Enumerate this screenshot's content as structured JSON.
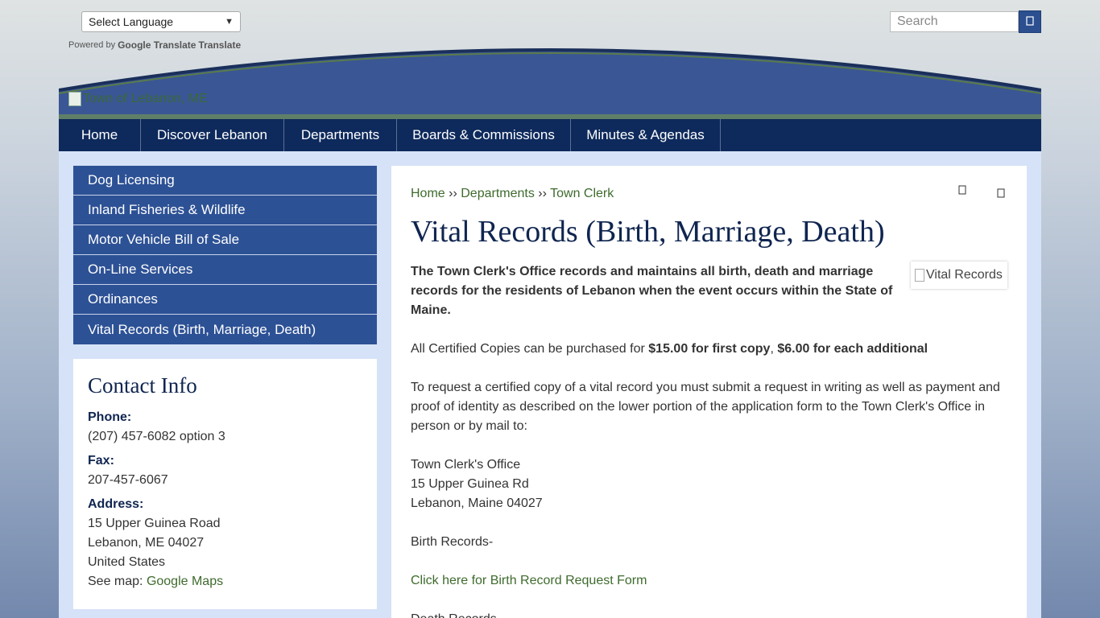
{
  "utility": {
    "language_select": "Select Language",
    "powered_by": "Powered by",
    "google_translate_logo": "Google Translate",
    "translate_link": "Translate",
    "search_placeholder": "Search"
  },
  "header": {
    "logo_alt": "Town of Lebanon, ME"
  },
  "nav": {
    "items": [
      {
        "label": "Home"
      },
      {
        "label": "Discover Lebanon"
      },
      {
        "label": "Departments"
      },
      {
        "label": "Boards & Commissions"
      },
      {
        "label": "Minutes & Agendas"
      }
    ]
  },
  "sidebar": {
    "items": [
      {
        "label": "Dog Licensing"
      },
      {
        "label": "Inland Fisheries & Wildlife"
      },
      {
        "label": "Motor Vehicle Bill of Sale"
      },
      {
        "label": "On-Line Services"
      },
      {
        "label": "Ordinances"
      },
      {
        "label": "Vital Records (Birth, Marriage, Death)"
      }
    ]
  },
  "contact": {
    "title": "Contact Info",
    "phone_label": "Phone:",
    "phone": "(207) 457-6082 option 3",
    "fax_label": "Fax:",
    "fax": "207-457-6067",
    "address_label": "Address:",
    "address_line1": "15 Upper Guinea Road",
    "address_line2": "Lebanon, ME 04027",
    "address_line3": "United States",
    "map_prefix": "See map:",
    "map_link": "Google Maps"
  },
  "main": {
    "breadcrumb": {
      "home": "Home",
      "sep": "››",
      "departments": "Departments",
      "town_clerk": "Town Clerk"
    },
    "title": "Vital Records (Birth, Marriage, Death)",
    "image_alt": "Vital Records",
    "intro": "The Town Clerk's Office records and maintains all birth, death and marriage records for the residents of Lebanon when the event occurs within the State of Maine.",
    "copies_prefix": "All Certified Copies can be purchased for",
    "copies_first": "$15.00 for first copy",
    "copies_sep": ",",
    "copies_additional": "$6.00 for each additional",
    "request_text": "To request a certified copy of a vital record you must submit a request in writing as well as payment and proof of identity as described on the lower portion of the application form to the Town Clerk's Office in person or by mail to:",
    "addr1": "Town Clerk's Office",
    "addr2": "15 Upper Guinea Rd",
    "addr3": "Lebanon, Maine 04027",
    "birth_heading": "Birth Records-",
    "birth_link": "Click here for Birth Record Request Form",
    "death_heading": "Death Records-"
  },
  "colors": {
    "nav_bg": "#0e2a5c",
    "sidebar_item_bg": "#2d5195",
    "header_blue": "#3a5694",
    "link_green": "#3e6b2d",
    "title_navy": "#0f2550"
  }
}
